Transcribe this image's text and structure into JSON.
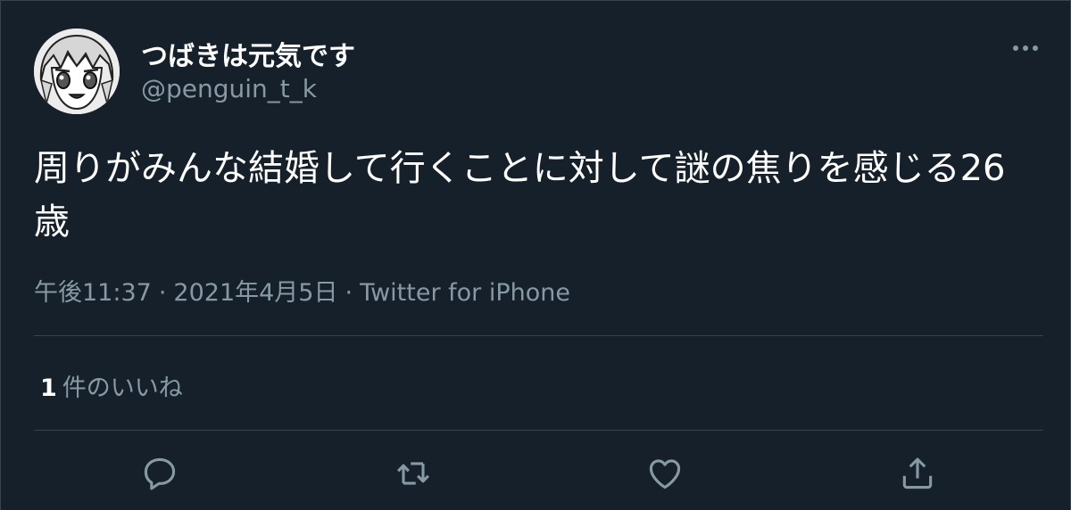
{
  "user": {
    "display_name": "つばきは元気です",
    "handle": "@penguin_t_k"
  },
  "tweet": {
    "text": "周りがみんな結婚して行くことに対して謎の焦りを感じる26歳",
    "time": "午後11:37",
    "date": "2021年4月5日",
    "separator": "·",
    "source": "Twitter for iPhone"
  },
  "stats": {
    "like_count": "1",
    "like_label": "件のいいね"
  },
  "icons": {
    "more": "more-horizontal-icon",
    "reply": "reply-bubble-icon",
    "retweet": "retweet-arrows-icon",
    "like": "heart-icon",
    "share": "share-upload-icon"
  },
  "colors": {
    "background": "#15202b",
    "text_primary": "#ffffff",
    "text_secondary": "#8899a6",
    "border": "#38444d"
  }
}
